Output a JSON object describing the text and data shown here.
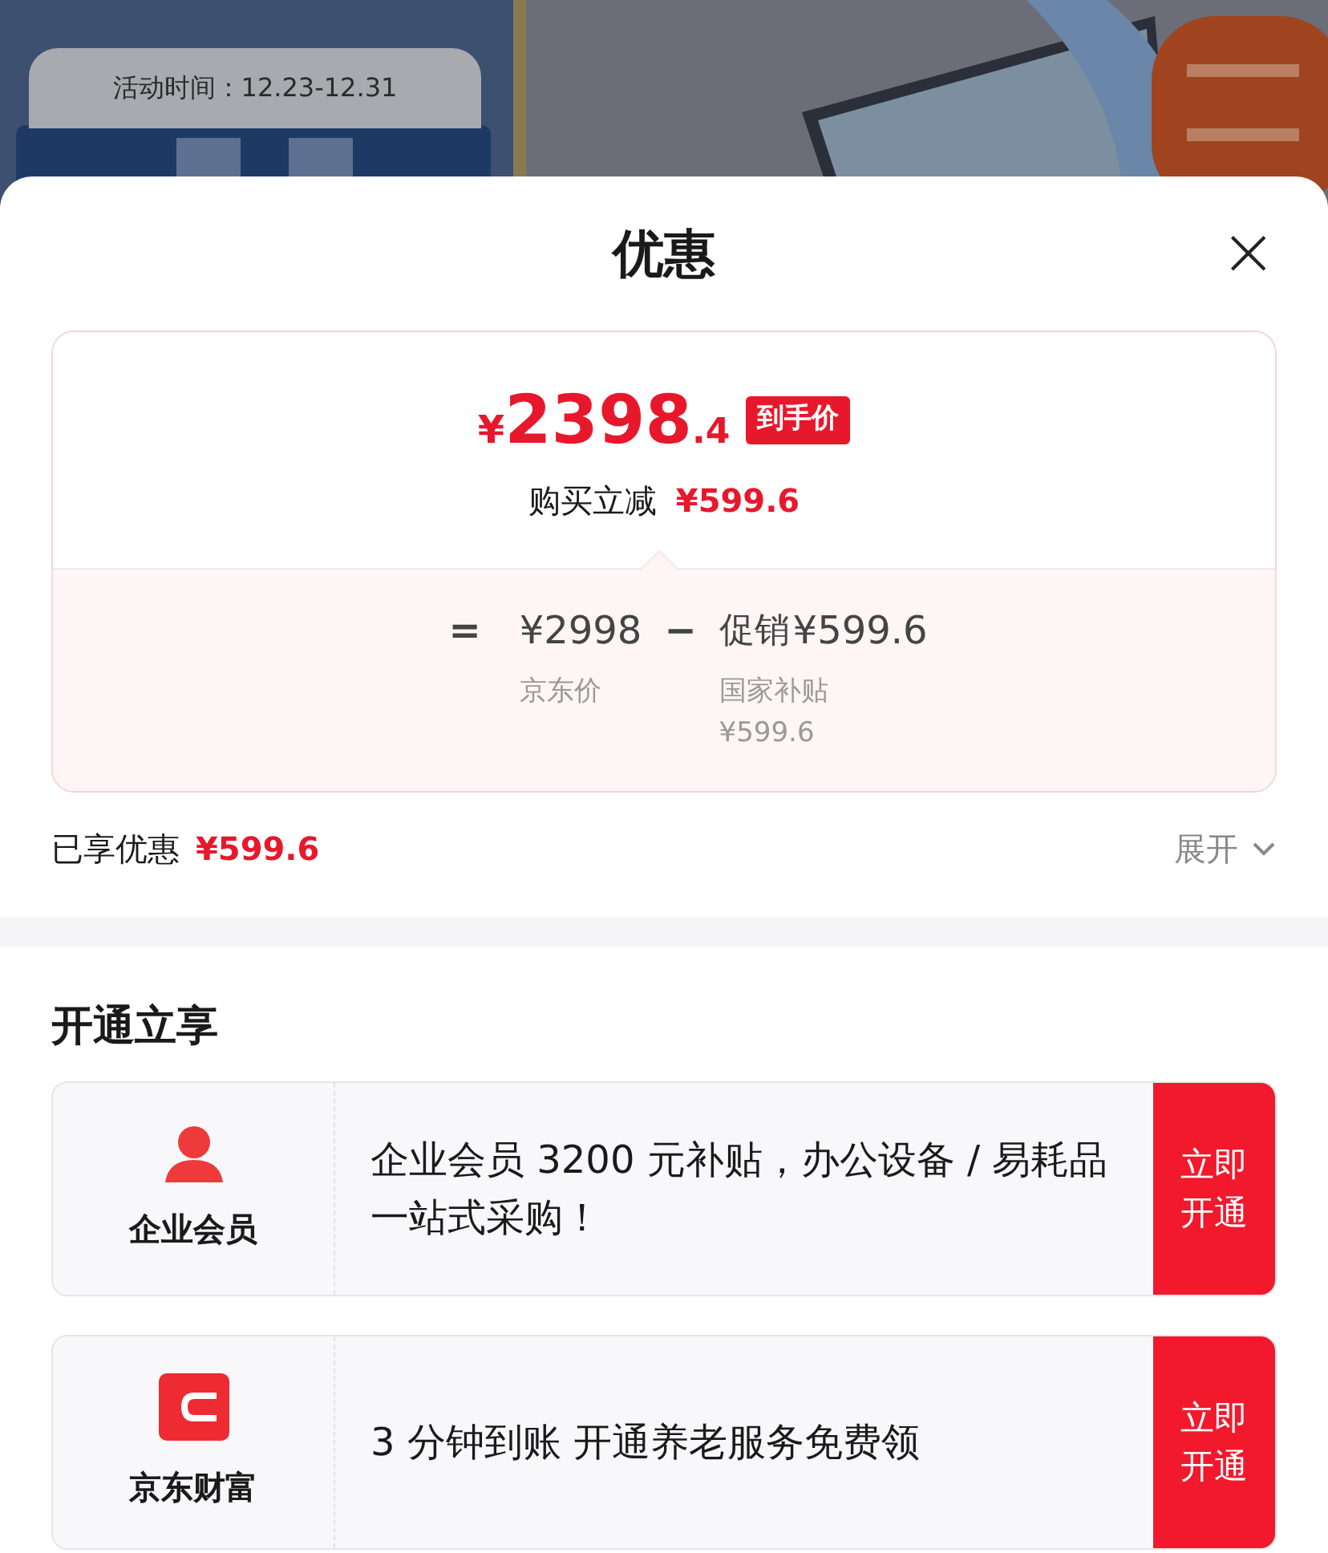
{
  "banner": {
    "kind": "picture",
    "event_time": "活动时间：12.23-12.31"
  },
  "sheet": {
    "title": "优惠",
    "close": "×"
  },
  "price_card": {
    "price": {
      "symbol": "¥",
      "integer": "2398",
      "decimal": ".4"
    },
    "price_badge": "到手价",
    "reduction_label": "购买立减",
    "reduction_value": "¥599.6",
    "formula": {
      "equals": "=",
      "base_price": "¥2998",
      "base_label": "京东价",
      "minus": "−",
      "promo_label": "促销",
      "promo_value": "¥599.6",
      "promo_sub_label": "国家补贴",
      "promo_sub_value": "¥599.6"
    }
  },
  "savings": {
    "label": "已享优惠",
    "value": "¥599.6",
    "toggle": "展开",
    "expanded": false
  },
  "section": {
    "title": "开通立享",
    "offers": [
      {
        "kind": "person",
        "name": "企业会员",
        "text": "企业会员 3200 元补贴，办公设备 / 易耗品一站式采购！",
        "action": "立即开通"
      },
      {
        "kind": "wallet",
        "name": "京东财富",
        "text": "3 分钟到账 开通养老服务免费领",
        "action": "立即开通"
      }
    ]
  }
}
